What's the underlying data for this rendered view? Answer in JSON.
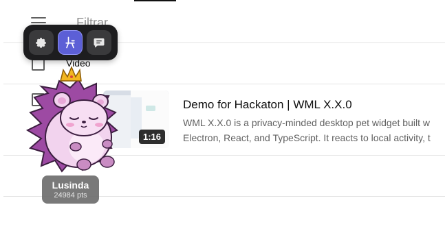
{
  "header": {
    "filter_label": "Filtrar",
    "column_video_label": "Video"
  },
  "rows": [
    {
      "title": "Demo for Hackaton | WML X.X.0",
      "description_line1": "WML X.X.0 is a privacy-minded desktop pet widget built w",
      "description_line2": "Electron, React, and TypeScript. It reacts to local activity, t",
      "duration": "1:16"
    }
  ],
  "pet_toolbar": {
    "icons": [
      "gear-icon",
      "pet-mode-icon",
      "chat-icon"
    ],
    "accent_color": "#5c5fd6"
  },
  "pet": {
    "name": "Lusinda",
    "points": "24984 pts"
  }
}
